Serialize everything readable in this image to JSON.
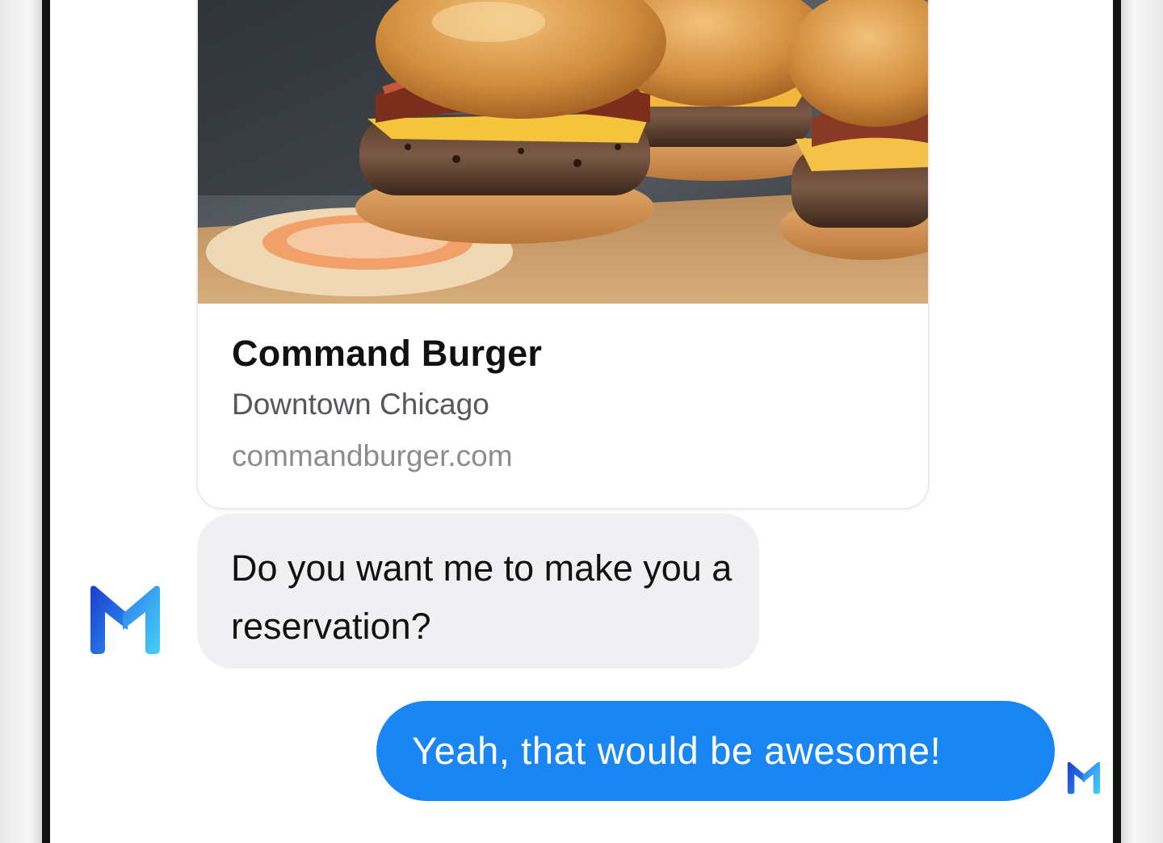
{
  "conversation": {
    "place_card": {
      "image_alt": "Burgers",
      "title": "Command Burger",
      "location": "Downtown Chicago",
      "website": "commandburger.com"
    },
    "incoming_message": {
      "text": "Do you want me to make you a reservation?",
      "sender_icon": "m-assistant-logo-icon"
    },
    "outgoing_message": {
      "text": "Yeah, that would be awesome!",
      "read_receipt_icon": "m-assistant-logo-icon"
    }
  },
  "colors": {
    "outgoing_bubble": "#1a86f4",
    "incoming_bubble": "#f0f0f2",
    "logo_dark": "#1c4fd6",
    "logo_light": "#3cc6f0"
  }
}
